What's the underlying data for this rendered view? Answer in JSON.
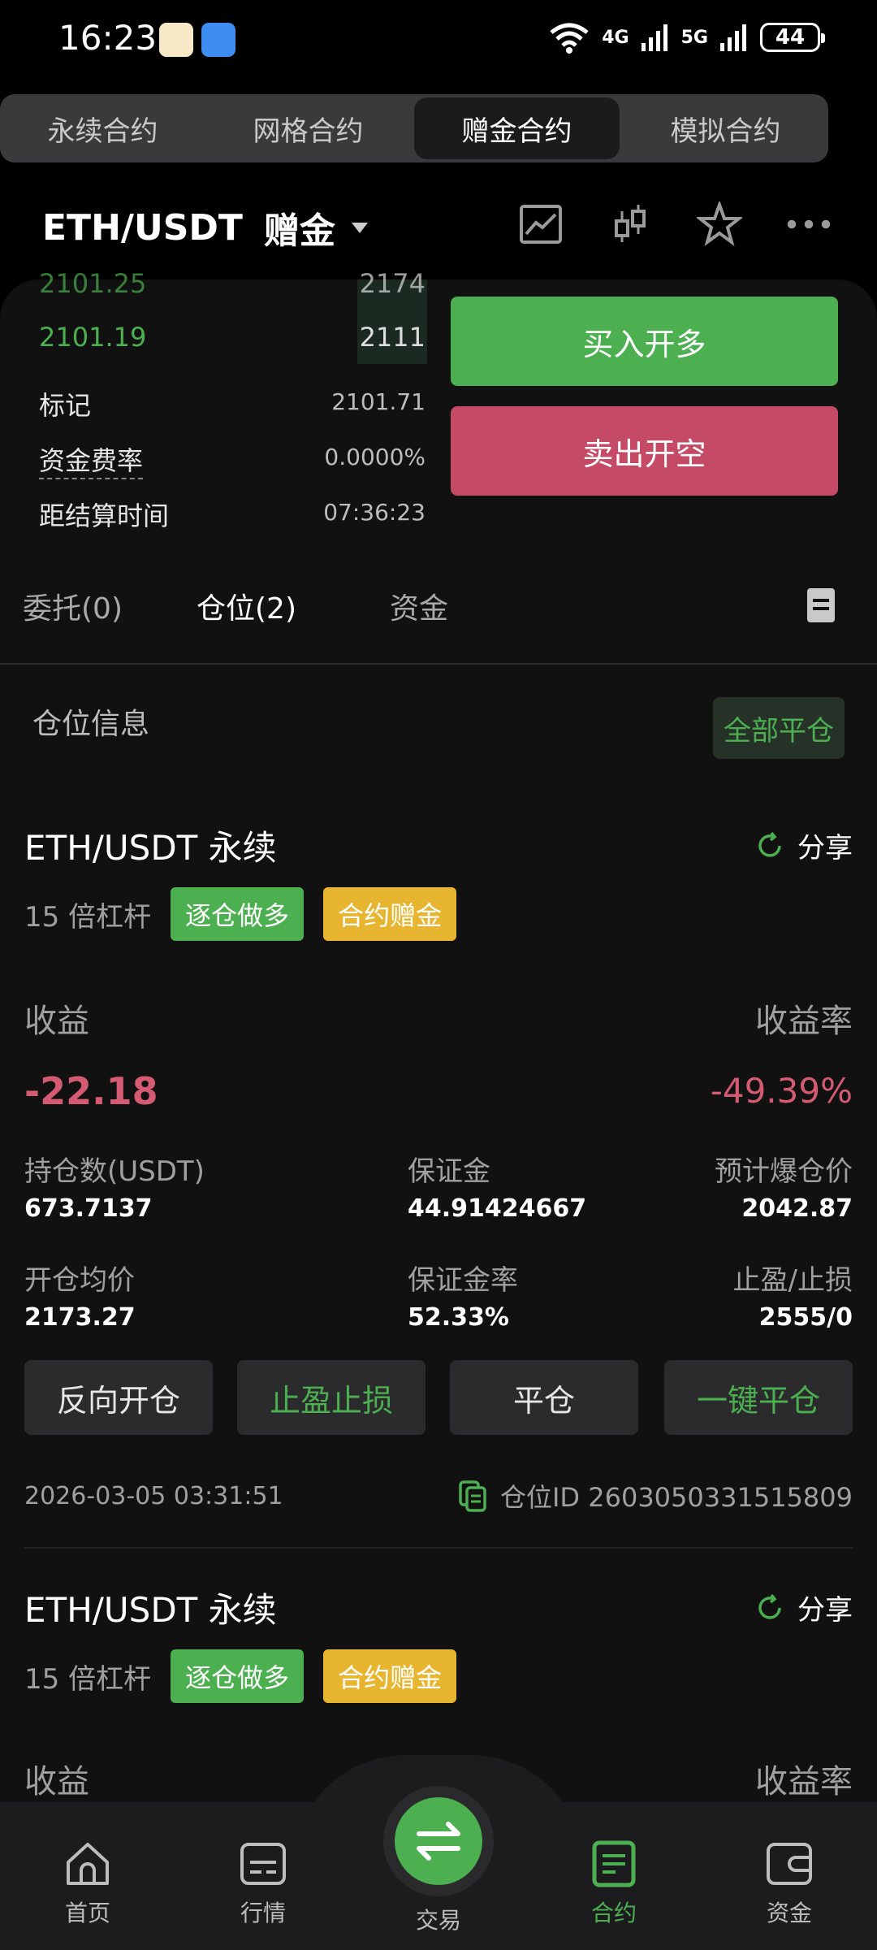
{
  "status_bar": {
    "time": "16:23",
    "battery": "44",
    "net1": "4G",
    "net2": "5G",
    "wifi_badge": "6"
  },
  "contract_tabs": [
    "永续合约",
    "网格合约",
    "赠金合约",
    "模拟合约"
  ],
  "header": {
    "pair": "ETH/USDT",
    "mode": "赠金"
  },
  "orderbook": {
    "rows": [
      {
        "price": "2101.25",
        "qty": "2174"
      },
      {
        "price": "2101.19",
        "qty": "2111"
      }
    ]
  },
  "market_info": {
    "mark_label": "标记",
    "mark_value": "2101.71",
    "funding_label": "资金费率",
    "funding_value": "0.0000%",
    "settle_label": "距结算时间",
    "settle_value": "07:36:23"
  },
  "actions": {
    "buy": "买入开多",
    "sell": "卖出开空"
  },
  "sub_tabs": [
    "委托(0)",
    "仓位(2)",
    "资金"
  ],
  "positions_header": {
    "title": "仓位信息",
    "close_all": "全部平仓"
  },
  "positions": [
    {
      "symbol": "ETH/USDT 永续",
      "share": "分享",
      "leverage": "15 倍杠杆",
      "tag1": "逐仓做多",
      "tag2": "合约赠金",
      "pnl_label": "收益",
      "pnl_value": "-22.18",
      "roe_label": "收益率",
      "roe_value": "-49.39%",
      "size_label": "持仓数(USDT)",
      "size_value": "673.7137",
      "margin_label": "保证金",
      "margin_value": "44.91424667",
      "liq_label": "预计爆仓价",
      "liq_value": "2042.87",
      "entry_label": "开仓均价",
      "entry_value": "2173.27",
      "margin_ratio_label": "保证金率",
      "margin_ratio_value": "52.33%",
      "tpsl_label": "止盈/止损",
      "tpsl_value": "2555/0",
      "buttons": [
        "反向开仓",
        "止盈止损",
        "平仓",
        "一键平仓"
      ],
      "time": "2026-03-05 03:31:51",
      "position_id": "仓位ID 2603050331515809"
    },
    {
      "symbol": "ETH/USDT 永续",
      "share": "分享",
      "leverage": "15 倍杠杆",
      "tag1": "逐仓做多",
      "tag2": "合约赠金",
      "pnl_label": "收益",
      "roe_label": "收益率"
    }
  ],
  "bottom_nav": [
    "首页",
    "行情",
    "交易",
    "合约",
    "资金"
  ],
  "colors": {
    "green": "#4caf50",
    "red": "#d45b72",
    "yellow": "#e7b52f",
    "bg": "#111111"
  }
}
